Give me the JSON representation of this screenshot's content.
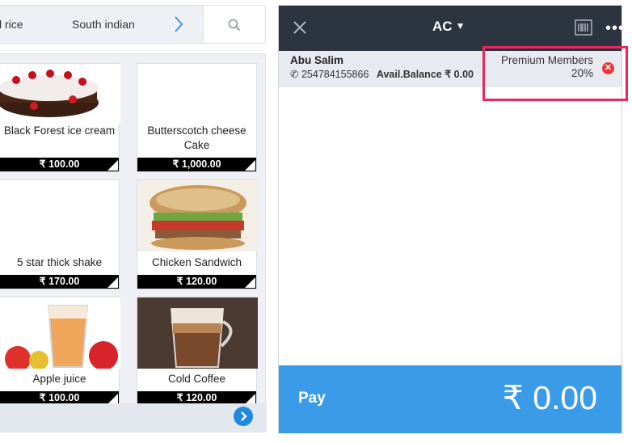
{
  "categories": {
    "items": [
      {
        "label": "l rice"
      },
      {
        "label": "South indian"
      }
    ]
  },
  "products": [
    {
      "name": "Black Forest ice cream",
      "price": "₹ 100.00"
    },
    {
      "name": "Butterscotch cheese Cake",
      "price": "₹ 1,000.00"
    },
    {
      "name": "5 star thick shake",
      "price": "₹ 170.00"
    },
    {
      "name": "Chicken Sandwich",
      "price": "₹ 120.00"
    },
    {
      "name": "Apple juice",
      "price": "₹ 100.00"
    },
    {
      "name": "Cold Coffee",
      "price": "₹ 120.00"
    }
  ],
  "order": {
    "table": "AC",
    "customer": {
      "name": "Abu Salim",
      "phone": "254784155866",
      "balance_label": "Avail.Balance",
      "balance": "₹ 0.00",
      "membership": "Premium Members",
      "discount": "20%"
    },
    "pay_label": "Pay",
    "total": "₹ 0.00"
  },
  "colors": {
    "header_bg": "#2c3440",
    "pay_bg": "#3a9be8",
    "highlight": "#e8275a",
    "accent": "#1e88e5"
  }
}
